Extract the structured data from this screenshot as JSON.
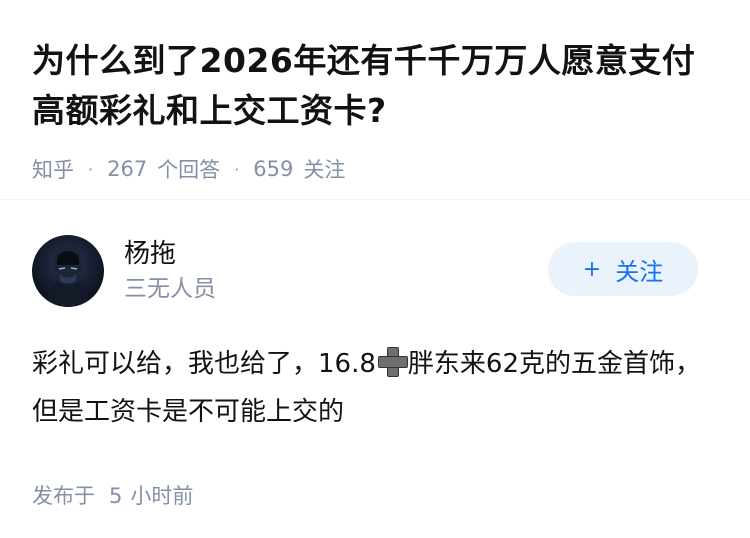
{
  "question": {
    "title": "为什么到了2026年还有千千万万人愿意支付高额彩礼和上交工资卡?",
    "source": "知乎",
    "answer_count": "267",
    "answer_label": "个回答",
    "follower_count": "659",
    "follower_label": "关注"
  },
  "answer": {
    "author_name": "杨拖",
    "author_badge": "三无人员",
    "follow_label": "关注",
    "follow_plus": "+",
    "content_part1": "彩礼可以给，我也给了，16.8",
    "content_icon": "heavy-plus-icon",
    "content_part2": "胖东来62克的五金首饰，但是工资卡是不可能上交的",
    "time_prefix": "发布于",
    "time_value": "5",
    "time_suffix": "小时前"
  },
  "colors": {
    "text": "#121212",
    "meta": "#8590a6",
    "accent": "#1772f6",
    "follow_bg": "#eaf2fb"
  }
}
